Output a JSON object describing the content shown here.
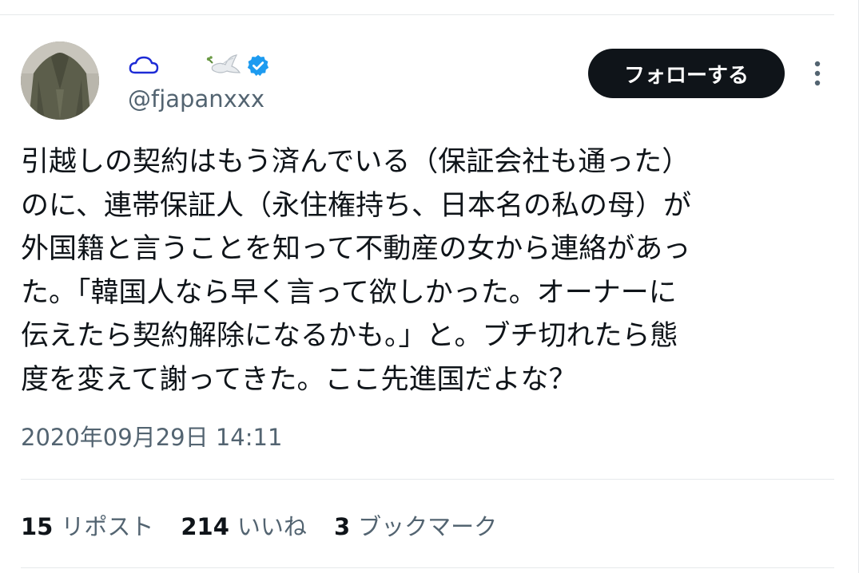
{
  "user": {
    "handle": "@fjapanxxx",
    "name_icons": [
      "cloud-icon",
      "dove-icon",
      "verified-icon"
    ],
    "avatar_icon": "avatar-photo"
  },
  "follow_button": {
    "label": "フォローする"
  },
  "more_icon": "more-vertical-icon",
  "tweet": {
    "text": "引越しの契約はもう済んでいる（保証会社も通った）\nのに、連帯保証人（永住権持ち、日本名の私の母）が\n外国籍と言うことを知って不動産の女から連絡があっ\nた。「韓国人なら早く言って欲しかった。オーナーに\n伝えたら契約解除になるかも。」と。ブチ切れたら態\n度を変えて謝ってきた。ここ先進国だよな？",
    "timestamp": "2020年09月29日 14:11"
  },
  "stats": {
    "reposts": {
      "count": "15",
      "label": "リポスト"
    },
    "likes": {
      "count": "214",
      "label": "いいね"
    },
    "bookmarks": {
      "count": "3",
      "label": "ブックマーク"
    }
  },
  "colors": {
    "text_primary": "#0f1419",
    "text_secondary": "#536471",
    "button_bg": "#0f1419",
    "verified_blue": "#1d9bf0",
    "cloud_blue": "#1d2bd6",
    "divider": "#e6e9eb"
  }
}
